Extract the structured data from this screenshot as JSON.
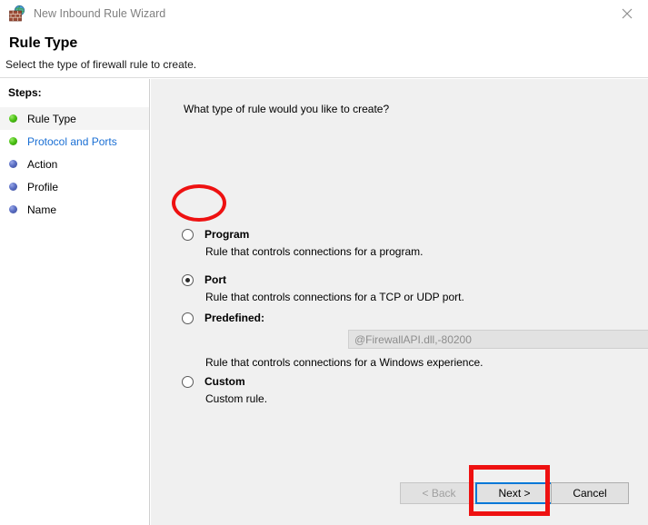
{
  "window": {
    "title": "New Inbound Rule Wizard",
    "icon": "firewall-icon",
    "close_label": "×"
  },
  "header": {
    "title": "Rule Type",
    "subtitle": "Select the type of firewall rule to create."
  },
  "sidebar": {
    "steps_title": "Steps:",
    "items": [
      {
        "label": "Rule Type",
        "bullet": "green",
        "state": "current"
      },
      {
        "label": "Protocol and Ports",
        "bullet": "green",
        "state": "link"
      },
      {
        "label": "Action",
        "bullet": "blue",
        "state": "pending"
      },
      {
        "label": "Profile",
        "bullet": "blue",
        "state": "pending"
      },
      {
        "label": "Name",
        "bullet": "blue",
        "state": "pending"
      }
    ]
  },
  "main": {
    "question": "What type of rule would you like to create?",
    "options": [
      {
        "label": "Program",
        "description": "Rule that controls connections for a program.",
        "selected": false
      },
      {
        "label": "Port",
        "description": "Rule that controls connections for a TCP or UDP port.",
        "selected": true
      },
      {
        "label": "Predefined:",
        "description": "Rule that controls connections for a Windows experience.",
        "selected": false
      },
      {
        "label": "Custom",
        "description": "Custom rule.",
        "selected": false
      }
    ],
    "predefined_combo": {
      "value": "@FirewallAPI.dll,-80200",
      "disabled": true
    }
  },
  "footer": {
    "back_label": "< Back",
    "next_label": "Next >",
    "cancel_label": "Cancel"
  },
  "annotations": {
    "accent_color": "#ee1111",
    "focus_color": "#0078d7",
    "ellipse_target": "Port radio option",
    "rect_target": "Next > button"
  }
}
